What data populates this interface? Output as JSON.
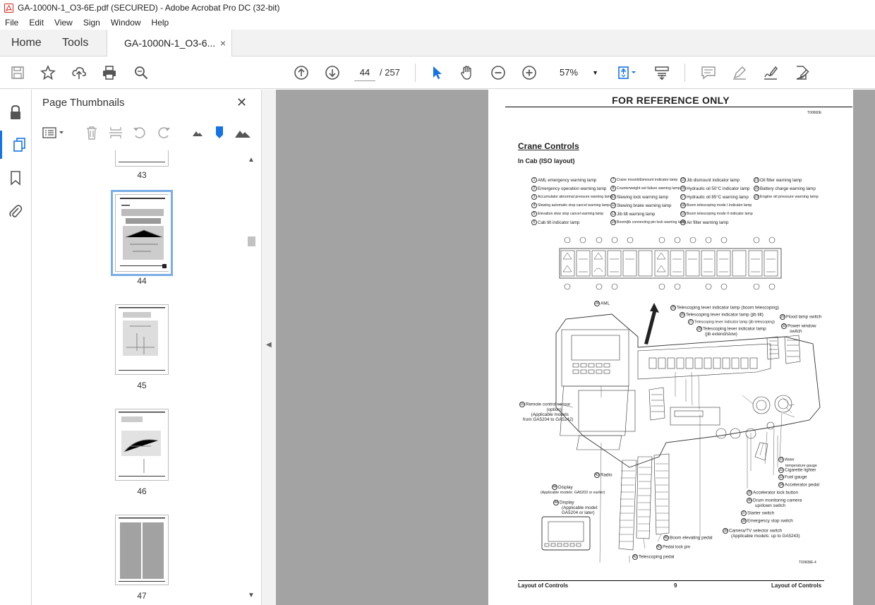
{
  "window": {
    "title": "GA-1000N-1_O3-6E.pdf (SECURED) - Adobe Acrobat Pro DC (32-bit)"
  },
  "menu": [
    "File",
    "Edit",
    "View",
    "Sign",
    "Window",
    "Help"
  ],
  "tabs": {
    "home": "Home",
    "tools": "Tools",
    "document": "GA-1000N-1_O3-6...",
    "close": "×"
  },
  "toolbar": {
    "page_current": "44",
    "page_total": "/ 257",
    "zoom": "57%"
  },
  "panel": {
    "title": "Page Thumbnails",
    "close": "✕",
    "thumbnails": [
      {
        "label": "43"
      },
      {
        "label": "44",
        "selected": true
      },
      {
        "label": "45"
      },
      {
        "label": "46"
      },
      {
        "label": "47"
      }
    ]
  },
  "document": {
    "header": "FOR REFERENCE ONLY",
    "code": "T00660E",
    "section": "Crane Controls",
    "subsection": "In Cab (ISO layout)",
    "legend": [
      {
        "n": "1",
        "t": "AML emergency warning lamp"
      },
      {
        "n": "2",
        "t": "Emergency operation warning lamp"
      },
      {
        "n": "3",
        "t": "Accumulator abnormal pressure warning lamp"
      },
      {
        "n": "4",
        "t": "Slewing automatic stop cancel warning lamp"
      },
      {
        "n": "5",
        "t": "Elevation slow stop cancel warning lamp"
      },
      {
        "n": "6",
        "t": "Cab tilt indicator lamp"
      },
      {
        "n": "7",
        "t": "Crane mount/dismount indicator lamp"
      },
      {
        "n": "8",
        "t": "Counterweight set failure warning lamp"
      },
      {
        "n": "11",
        "t": "Slewing lock warning lamp"
      },
      {
        "n": "12",
        "t": "Slewing brake warning lamp"
      },
      {
        "n": "13",
        "t": "Jib tilt warning lamp"
      },
      {
        "n": "14",
        "t": "Boom/jib connecting pin lock warning lamp"
      },
      {
        "n": "15",
        "t": "Jib dismount indicator lamp"
      },
      {
        "n": "16",
        "t": "Hydraulic oil 50°C indicator lamp"
      },
      {
        "n": "17",
        "t": "Hydraulic oil 85°C warning lamp"
      },
      {
        "n": "18",
        "t": "Boom telescoping mode I indicator lamp"
      },
      {
        "n": "19",
        "t": "Boom telescoping mode II indicator lamp"
      },
      {
        "n": "20",
        "t": "Air filter warning lamp"
      },
      {
        "n": "21",
        "t": "Oil filter warning lamp"
      },
      {
        "n": "22",
        "t": "Battery charge warning lamp"
      },
      {
        "n": "23",
        "t": "Engine oil pressure warning lamp"
      }
    ],
    "callouts": {
      "c24": "AML",
      "c25": "Telescoping lever indicator lamp (boom telescoping)",
      "c26": "Telescoping lever indicator lamp (jib tilt)",
      "c27": "Telescoping lever indicator lamp (jib telescoping)",
      "c28a": "Telescoping lever indicator lamp",
      "c28b": "(jib extend/stow)",
      "c29": "Flood lamp switch",
      "c30a": "Power window",
      "c30b": "switch",
      "c10a": "Remote control sensor",
      "c10b": "(option)",
      "c10c": "(Applicable models",
      "c10d": "from GA5204 to GA5242)",
      "c43": "Radio",
      "c44a_t": "Display",
      "c44a_s": "(Applicable models: GA5203 or earlier)",
      "c44b_t": "Display",
      "c44b_s1": "(Applicable model:",
      "c44b_s2": "GA5204 or later)",
      "c31a": "Water",
      "c31b": "temperature gauge",
      "c32": "Cigarette lighter",
      "c33": "Fuel gauge",
      "c34": "Accelerator pedal",
      "c35": "Accelerator lock button",
      "c36a": "Drum monitoring camera",
      "c36b": "up/down switch",
      "c37": "Starter switch",
      "c38": "Emergency stop switch",
      "c39a": "Camera/TV selector switch",
      "c39b": "(Applicable models: up to GA5243)",
      "c40": "Boom elevating pedal",
      "c41": "Pedal lock pin",
      "c42": "Telescoping pedal"
    },
    "figure_code": "T00608E-4",
    "footer_left": "Layout of Controls",
    "footer_page": "9",
    "footer_right": "Layout of Controls"
  }
}
